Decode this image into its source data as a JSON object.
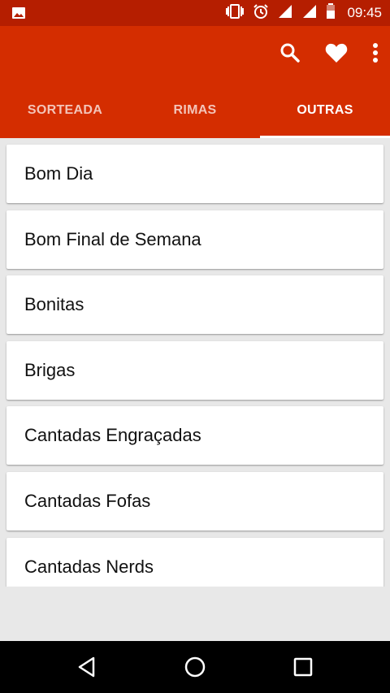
{
  "status_bar": {
    "time": "09:45",
    "icons": [
      "image-notification-icon",
      "vibrate-icon",
      "alarm-icon",
      "signal-icon",
      "signal-icon",
      "battery-icon"
    ]
  },
  "toolbar": {
    "actions": [
      "search-icon",
      "favorite-heart-icon",
      "more-vert-icon"
    ]
  },
  "tabs": [
    {
      "label": "SORTEADA",
      "active": false
    },
    {
      "label": "RIMAS",
      "active": false
    },
    {
      "label": "OUTRAS",
      "active": true
    }
  ],
  "list": {
    "items": [
      {
        "label": "Bom Dia"
      },
      {
        "label": "Bom Final de Semana"
      },
      {
        "label": "Bonitas"
      },
      {
        "label": "Brigas"
      },
      {
        "label": "Cantadas Engraçadas"
      },
      {
        "label": "Cantadas Fofas"
      },
      {
        "label": "Cantadas Nerds"
      }
    ]
  },
  "nav_bar": {
    "buttons": [
      "back-icon",
      "home-icon",
      "recents-icon"
    ]
  },
  "colors": {
    "status_bar": "#b51e00",
    "app_bar": "#d42d00",
    "background": "#e8e8e8"
  }
}
